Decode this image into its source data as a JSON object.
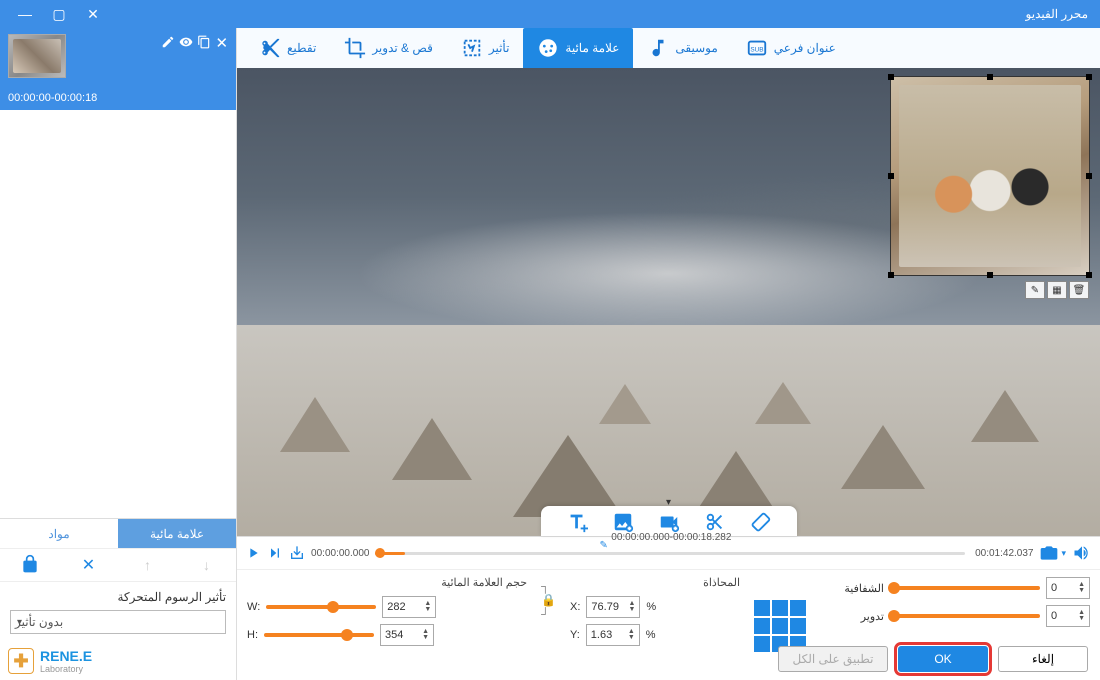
{
  "window": {
    "title": "محرر الفيديو"
  },
  "sidebar": {
    "clip_time": "00:00:00-00:00:18",
    "tabs": {
      "watermark": "علامة مائية",
      "materials": "مواد"
    },
    "anim_label": "تأثير الرسوم المتحركة",
    "anim_value": "بدون تأثير",
    "logo_name": "RENE.E",
    "logo_sub": "Laboratory"
  },
  "tabs": {
    "cut": "تقطيع",
    "crop": "قص & تدوير",
    "effect": "تأثير",
    "watermark": "علامة مائية",
    "music": "موسيقى",
    "subtitle": "عنوان فرعي"
  },
  "timeline": {
    "start": "00:00:00.000",
    "range": "00:00:00.000-00:00:18.282",
    "total": "00:01:42.037"
  },
  "controls": {
    "size_label": "حجم العلامة المائية",
    "align_label": "المحاذاة",
    "w_label": "W:",
    "h_label": "H:",
    "x_label": "X:",
    "y_label": "Y:",
    "w": "282",
    "h": "354",
    "x": "76.79",
    "y": "1.63",
    "pct": "%",
    "opacity_label": "الشفافية",
    "rotate_label": "تدوير",
    "opacity": "0",
    "rotate": "0"
  },
  "buttons": {
    "apply_all": "تطبيق على الكل",
    "ok": "OK",
    "cancel": "إلغاء"
  }
}
